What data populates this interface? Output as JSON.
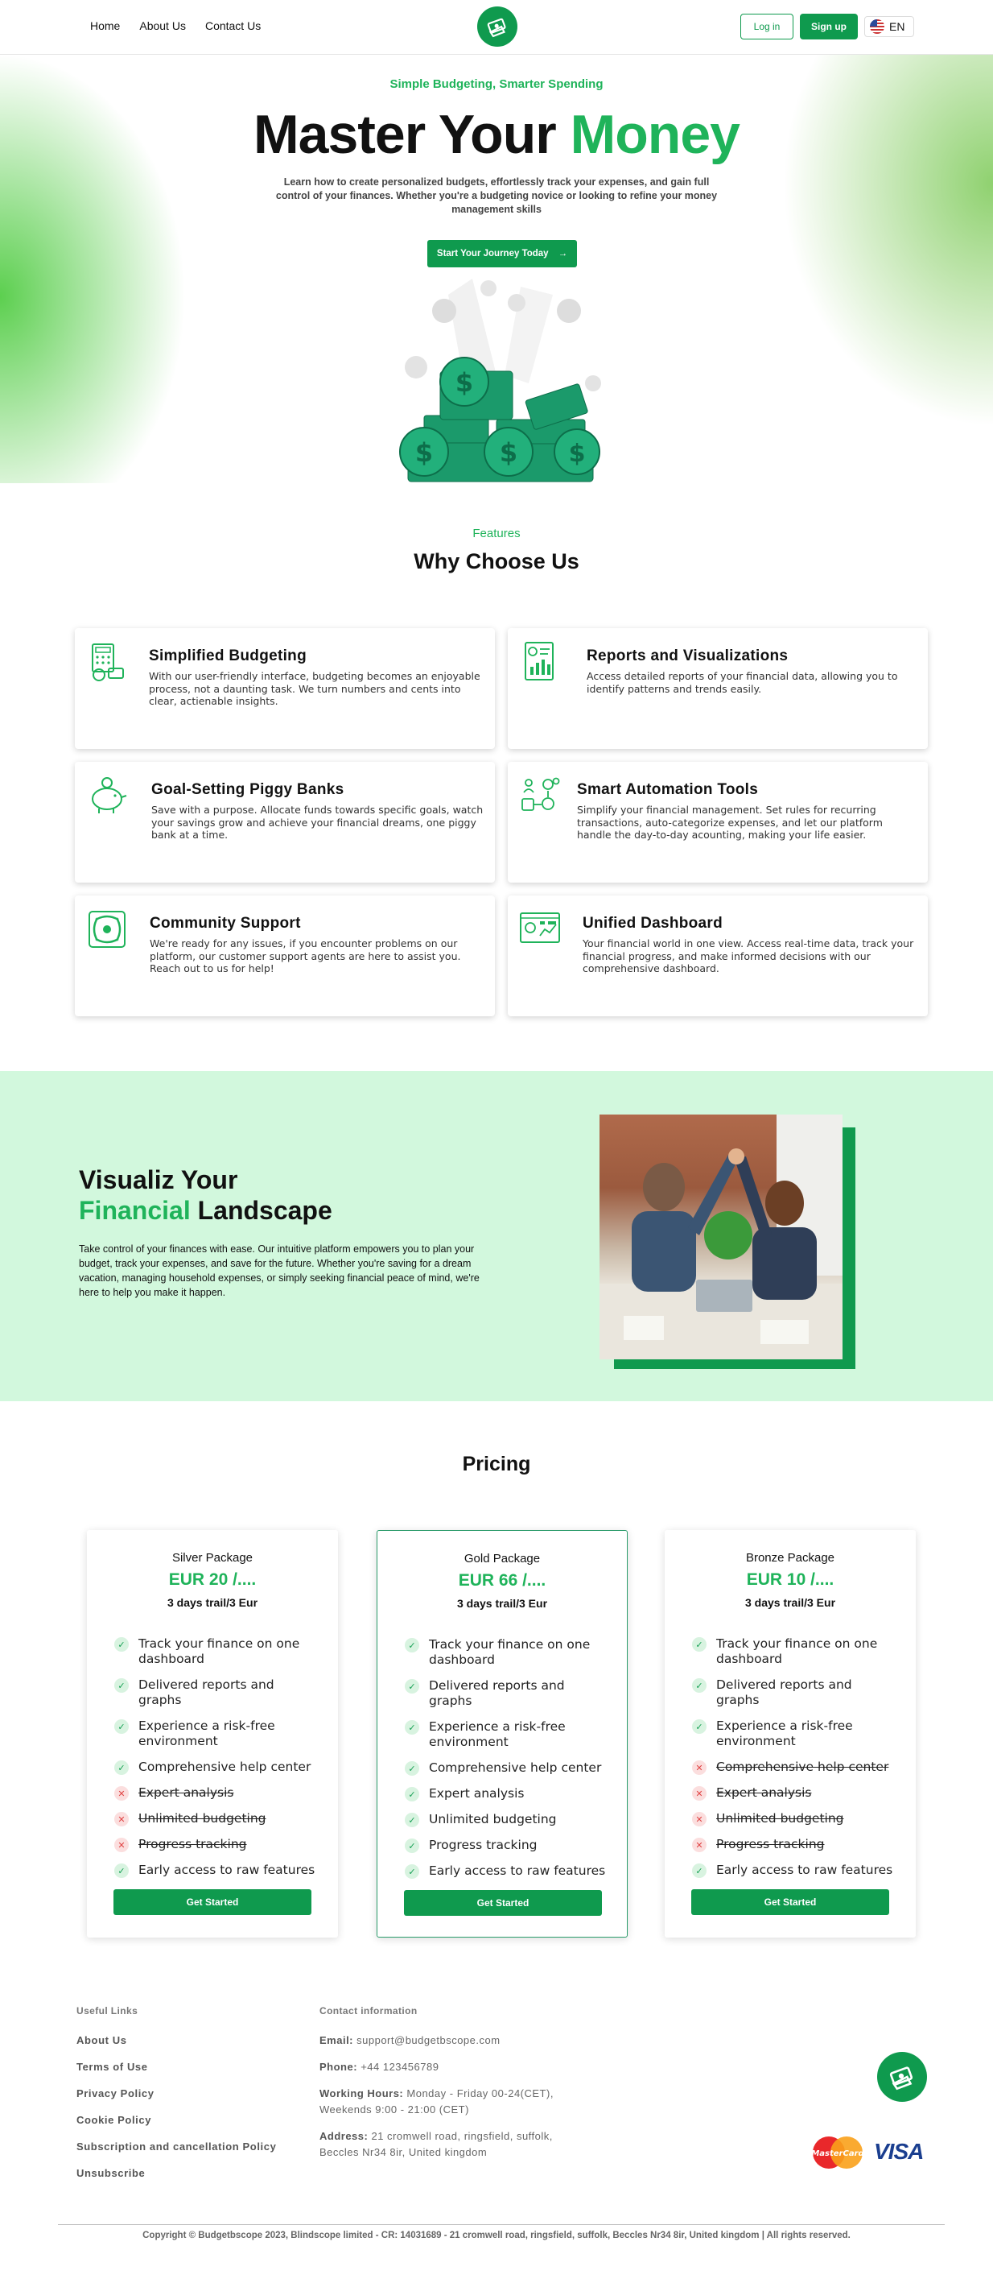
{
  "nav": {
    "links": [
      "Home",
      "About Us",
      "Contact Us"
    ],
    "login": "Log in",
    "signup": "Sign up",
    "language": "EN"
  },
  "hero": {
    "kicker": "Simple Budgeting, Smarter Spending",
    "title_main": "Master Your",
    "title_accent": "Money",
    "description": "Learn how to create personalized budgets, effortlessly track your expenses, and gain full control of your finances. Whether you're a budgeting novice or looking to refine your money management skills",
    "cta": "Start Your Journey Today"
  },
  "features": {
    "kicker": "Features",
    "title": "Why Choose Us",
    "items": [
      {
        "title": "Simplified Budgeting",
        "text": "With our user-friendly interface, budgeting becomes an enjoyable process, not a daunting task. We turn numbers and cents into clear, actienable insights.",
        "icon": "calculator-icon"
      },
      {
        "title": "Reports and Visualizations",
        "text": "Access detailed reports of your financial data, allowing you to identify patterns and trends easily.",
        "icon": "report-chart-icon"
      },
      {
        "title": "Goal-Setting Piggy Banks",
        "text": "Save with a purpose. Allocate funds towards specific goals, watch your savings grow and achieve your financial dreams, one piggy bank at a time.",
        "icon": "piggy-bank-icon"
      },
      {
        "title": "Smart Automation Tools",
        "text": "Simplify your financial management. Set rules for recurring transactions, auto-categorize expenses, and let our platform handle the day-to-day acounting, making your life easier.",
        "icon": "automation-icon"
      },
      {
        "title": "Community Support",
        "text": "We're ready for any issues, if you encounter problems on our platform, our customer support agents are here to assist you. Reach out to us for help!",
        "icon": "community-icon"
      },
      {
        "title": "Unified Dashboard",
        "text": "Your financial world in one view. Access real-time data, track your financial progress, and make informed decisions with our comprehensive dashboard.",
        "icon": "dashboard-icon"
      }
    ]
  },
  "visualize": {
    "title_line1": "Visualiz Your",
    "title_accent": "Financial",
    "title_rest": "Landscape",
    "description": "Take control of your finances with ease. Our intuitive platform empowers you to plan your budget, track your expenses, and save for the future. Whether you're saving for a dream vacation, managing household expenses, or simply seeking financial peace of mind, we're here to help you make it happen."
  },
  "pricing": {
    "title": "Pricing",
    "button": "Get Started",
    "plans": [
      {
        "name": "Silver Package",
        "price": "EUR 20 /....",
        "trial": "3 days trail/3 Eur",
        "features": [
          {
            "text": "Track your finance on one dashboard",
            "included": true
          },
          {
            "text": "Delivered reports and graphs",
            "included": true
          },
          {
            "text": "Experience a risk-free environment",
            "included": true
          },
          {
            "text": "Comprehensive help center",
            "included": true
          },
          {
            "text": "Expert analysis",
            "included": false
          },
          {
            "text": "Unlimited budgeting",
            "included": false
          },
          {
            "text": "Progress tracking",
            "included": false
          },
          {
            "text": "Early access to raw features",
            "included": true
          }
        ]
      },
      {
        "name": "Gold Package",
        "price": "EUR 66 /....",
        "trial": "3 days trail/3 Eur",
        "features": [
          {
            "text": "Track your finance on one dashboard",
            "included": true
          },
          {
            "text": "Delivered reports and graphs",
            "included": true
          },
          {
            "text": "Experience a risk-free environment",
            "included": true
          },
          {
            "text": "Comprehensive help center",
            "included": true
          },
          {
            "text": "Expert analysis",
            "included": true
          },
          {
            "text": "Unlimited budgeting",
            "included": true
          },
          {
            "text": "Progress tracking",
            "included": true
          },
          {
            "text": "Early access to raw features",
            "included": true
          }
        ]
      },
      {
        "name": "Bronze Package",
        "price": "EUR 10 /....",
        "trial": "3 days trail/3 Eur",
        "features": [
          {
            "text": "Track your finance on one dashboard",
            "included": true
          },
          {
            "text": "Delivered reports and graphs",
            "included": true
          },
          {
            "text": "Experience a risk-free environment",
            "included": true
          },
          {
            "text": "Comprehensive help center",
            "included": false
          },
          {
            "text": "Expert analysis",
            "included": false
          },
          {
            "text": "Unlimited budgeting",
            "included": false
          },
          {
            "text": "Progress tracking",
            "included": false
          },
          {
            "text": "Early access to raw features",
            "included": true
          }
        ]
      }
    ]
  },
  "footer": {
    "useful_links_heading": "Useful Links",
    "links": [
      "About Us",
      "Terms of Use",
      "Privacy Policy",
      "Cookie Policy",
      "Subscription and cancellation Policy",
      "Unsubscribe"
    ],
    "contact_heading": "Contact information",
    "email_label": "Email:",
    "email": "support@budgetbscope.com",
    "phone_label": "Phone:",
    "phone": "+44 123456789",
    "hours_label": "Working Hours:",
    "hours": "Monday - Friday 00-24(CET), Weekends 9:00 - 21:00 (CET)",
    "address_label": "Address:",
    "address": "21 cromwell road, ringsfield, suffolk, Beccles Nr34 8ir, United kingdom",
    "mastercard": "MasterCard",
    "visa": "VISA",
    "copyright": "Copyright © Budgetbscope 2023, Blindscope limited - CR: 14031689 - 21 cromwell road, ringsfield, suffolk, Beccles Nr34 8ir, United kingdom | All rights reserved."
  },
  "colors": {
    "brand_green": "#0f9a4e",
    "accent_green": "#1fb35a",
    "visualize_bg": "#d2f8dd"
  }
}
